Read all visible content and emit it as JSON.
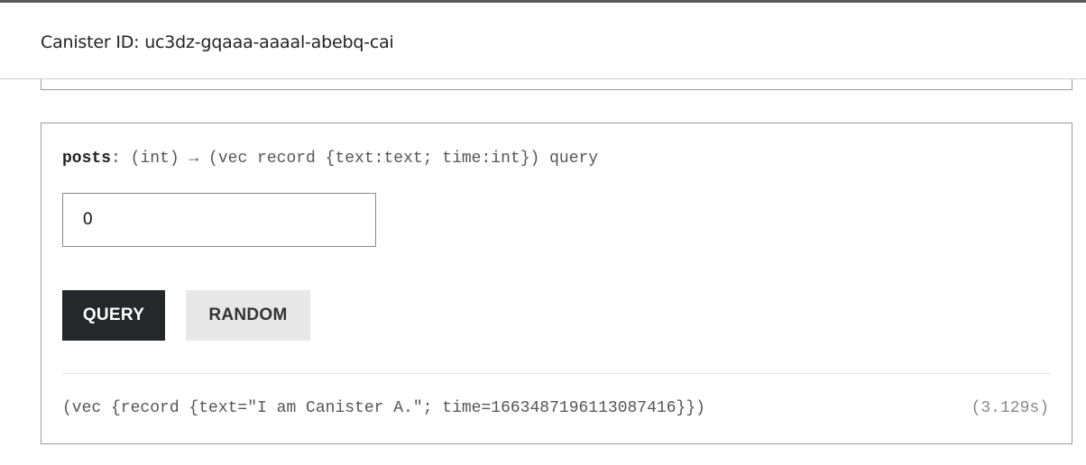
{
  "header": {
    "canister_id_text": "Canister ID: uc3dz-gqaaa-aaaal-abebq-cai"
  },
  "method": {
    "name": "posts",
    "signature": ": (int) → (vec record {text:text; time:int}) query",
    "argument_value": "0"
  },
  "buttons": {
    "query_label": "QUERY",
    "random_label": "RANDOM"
  },
  "result": {
    "output": "(vec {record {text=\"I am Canister A.\"; time=1663487196113087416}})",
    "duration": "(3.129s)"
  },
  "colors": {
    "query_button_bg": "#25272b",
    "random_button_bg": "#e8e8e8",
    "border": "#9a9a9a"
  }
}
